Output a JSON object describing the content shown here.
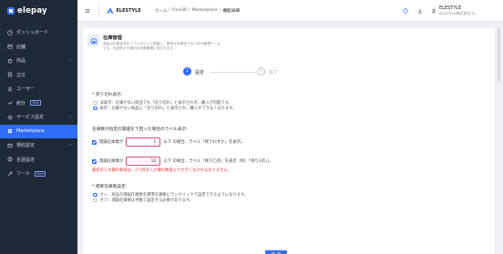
{
  "app": {
    "name": "elepay"
  },
  "sidebar": {
    "items": [
      {
        "label": "ダッシュボード",
        "icon": "dashboard-icon"
      },
      {
        "label": "店舗",
        "icon": "store-icon"
      },
      {
        "label": "商品",
        "icon": "product-icon"
      },
      {
        "label": "注文",
        "icon": "order-icon"
      },
      {
        "label": "ユーザー",
        "icon": "user-icon"
      },
      {
        "label": "統計",
        "icon": "chart-icon",
        "badge": "Beta"
      },
      {
        "label": "サービス設定",
        "icon": "gear-icon"
      },
      {
        "label": "Marketplace",
        "icon": "marketplace-icon"
      },
      {
        "label": "規約設定",
        "icon": "terms-icon"
      },
      {
        "label": "言語設定",
        "icon": "globe-icon"
      },
      {
        "label": "ツール",
        "icon": "wrench-icon",
        "badge": "Beta"
      }
    ]
  },
  "topbar": {
    "company": "ELESTYLE",
    "breadcrumb": [
      "ホーム",
      "OneQR",
      "Marketplace",
      "機能詳細"
    ],
    "user": {
      "name": "ELESTYLE",
      "org": "ELESTYLE株式会社(ス..."
    }
  },
  "header": {
    "title": "在庫管理",
    "description": "商品の在庫状況をリアルタイムで把握し、販売を効率化するための管理ツールです。欠品防止や適切な在庫管理に役立ちます。"
  },
  "steps": [
    {
      "num": "1",
      "label": "設定"
    },
    {
      "num": "2",
      "label": "完了"
    }
  ],
  "form": {
    "soldout": {
      "title": "* 売り切れ表示:",
      "options": [
        "非表示：在庫がない商品でも「売り切れ」と表示されず、購入が可能です。",
        "表示：在庫がない商品に「売り切れ」と表示され、購入ができなくなります。"
      ]
    },
    "label_section": {
      "title": "在庫数が指定の閾値を下回った場合のラベル表示:",
      "row1": {
        "prefix": "理論在庫数が",
        "value": "1",
        "suffix": "以下 の場合、ラベル「残りわずか」を表示。"
      },
      "row2": {
        "prefix": "理論在庫数が",
        "value": "10",
        "suffix": "以下 の場合、ラベル「残り〇点」を表示（例：「残り3点」)。"
      },
      "warning": "最初の入力欄の数値は、2つ目の入力欄の数値より大きくなければなりません。"
    },
    "standard": {
      "title": "* 標準在庫数設定:",
      "options": [
        "オン：商品の理論在庫数を標準在庫数にワンクリックで設定できるようになります。",
        "オフ：理論在庫数は手動で設定する必要があります。"
      ]
    }
  },
  "confirm_label": "確 認"
}
